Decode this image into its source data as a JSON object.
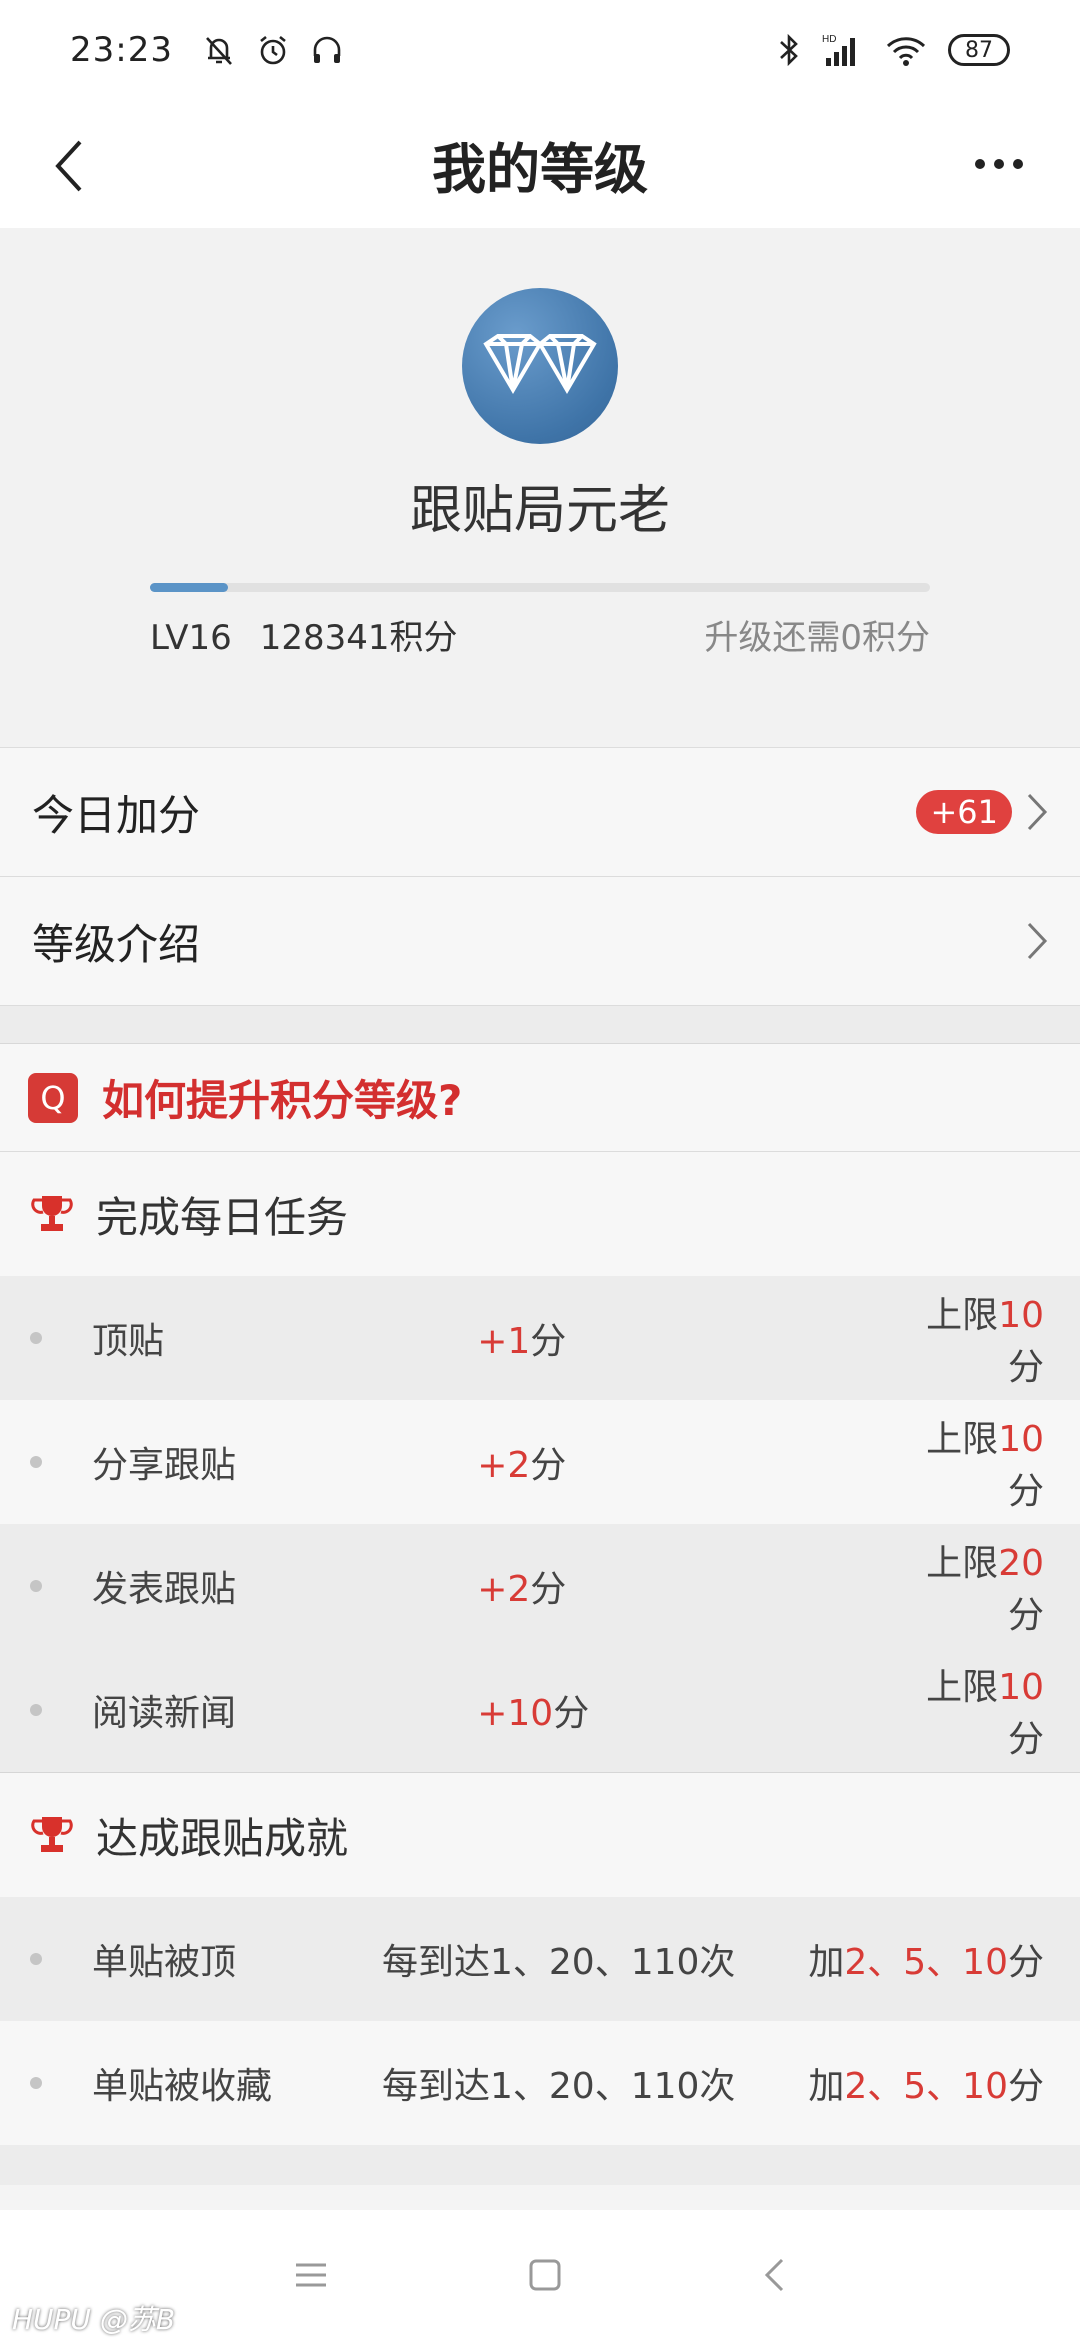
{
  "status_bar": {
    "time": "23:23",
    "battery": "87"
  },
  "nav": {
    "title": "我的等级"
  },
  "hero": {
    "level_title": "跟贴局元老",
    "level": "LV16",
    "points": "128341积分",
    "upgrade_need": "升级还需0积分",
    "progress": 0.1
  },
  "list": [
    {
      "label": "今日加分",
      "badge": "+61"
    },
    {
      "label": "等级介绍"
    }
  ],
  "howto": {
    "icon_text": "Q",
    "title": "如何提升积分等级?"
  },
  "daily": {
    "title": "完成每日任务",
    "rows": [
      {
        "name": "顶贴",
        "score_prefix": "+",
        "score_value": "1",
        "score_unit": "分",
        "limit_prefix": "上限",
        "limit_value": "10",
        "limit_unit": "分"
      },
      {
        "name": "分享跟贴",
        "score_prefix": "+",
        "score_value": "2",
        "score_unit": "分",
        "limit_prefix": "上限",
        "limit_value": "10",
        "limit_unit": "分"
      },
      {
        "name": "发表跟贴",
        "score_prefix": "+",
        "score_value": "2",
        "score_unit": "分",
        "limit_prefix": "上限",
        "limit_value": "20",
        "limit_unit": "分"
      },
      {
        "name": "阅读新闻",
        "score_prefix": "+",
        "score_value": "10",
        "score_unit": "分",
        "limit_prefix": "上限",
        "limit_value": "10",
        "limit_unit": "分"
      }
    ]
  },
  "achievements": {
    "title": "达成跟贴成就",
    "rows": [
      {
        "name": "单贴被顶",
        "condition": "每到达1、20、110次",
        "reward_prefix": "加",
        "reward_values": "2、5、10",
        "reward_unit": "分"
      },
      {
        "name": "单贴被收藏",
        "condition": "每到达1、20、110次",
        "reward_prefix": "加",
        "reward_values": "2、5、10",
        "reward_unit": "分"
      }
    ]
  },
  "watermark": "HUPU @苏B",
  "colors": {
    "accent_red": "#d83b36",
    "badge_blue": "#3f74a8",
    "progress_blue": "#5b94c7"
  },
  "icons": [
    "mute-bell-icon",
    "alarm-icon",
    "headset-icon",
    "bluetooth-icon",
    "signal-icon",
    "wifi-icon",
    "back-arrow-icon",
    "more-dots-icon",
    "diamond-badge-icon",
    "chevron-right-icon",
    "trophy-icon"
  ]
}
